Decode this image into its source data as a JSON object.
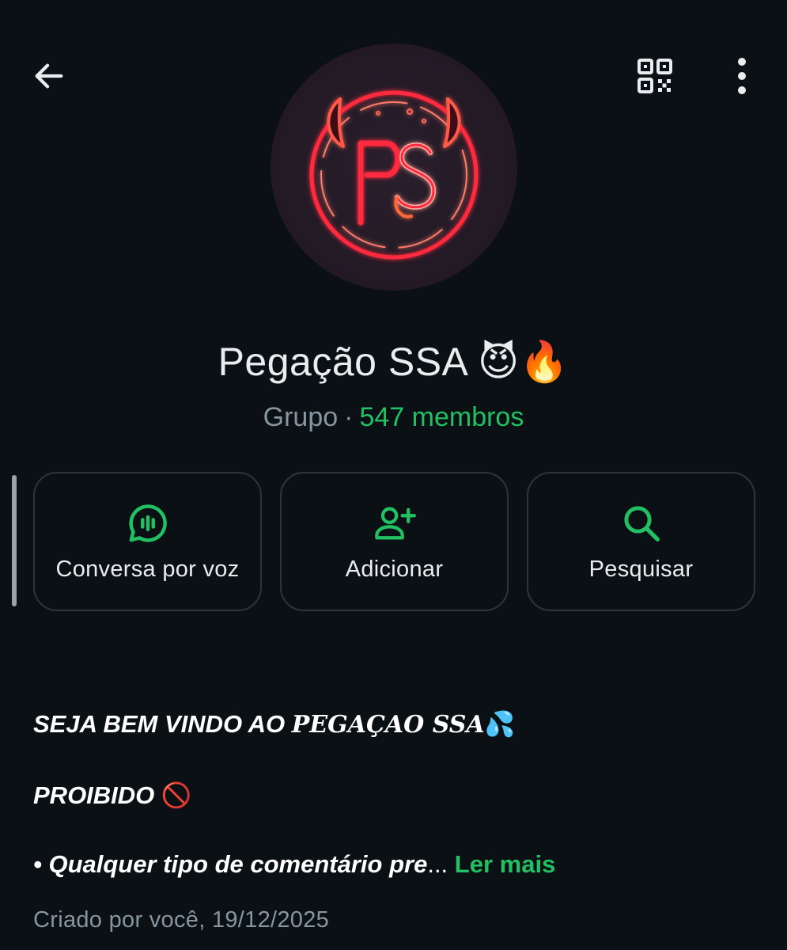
{
  "header": {
    "back_icon": "arrow-left-icon",
    "qr_icon": "qr-code-icon",
    "more_icon": "more-vertical-icon"
  },
  "group": {
    "name": "Pegação SSA",
    "name_emoji": "😈🔥",
    "avatar_text": "PS",
    "kind": "Grupo",
    "separator": "·",
    "members": "547 membros"
  },
  "actions": [
    {
      "label": "Conversa por voz",
      "icon": "voice-chat-icon"
    },
    {
      "label": "Adicionar",
      "icon": "add-person-icon"
    },
    {
      "label": "Pesquisar",
      "icon": "search-icon"
    }
  ],
  "description": {
    "line1_a": "SEJA BEM VINDO AO ",
    "line1_b": "PEGAÇAO SSA",
    "line1_emoji": "💦",
    "line2": "PROIBIDO ",
    "line2_emoji": "🚫",
    "line3": "• Qualquer tipo de comentário pre",
    "ellipsis": "...",
    "read_more": "Ler mais"
  },
  "created": "Criado por você, 19/12/2025",
  "colors": {
    "background": "#0b1014",
    "accent": "#21c063",
    "muted": "#8696a0",
    "neon": "#ff2a3c"
  }
}
